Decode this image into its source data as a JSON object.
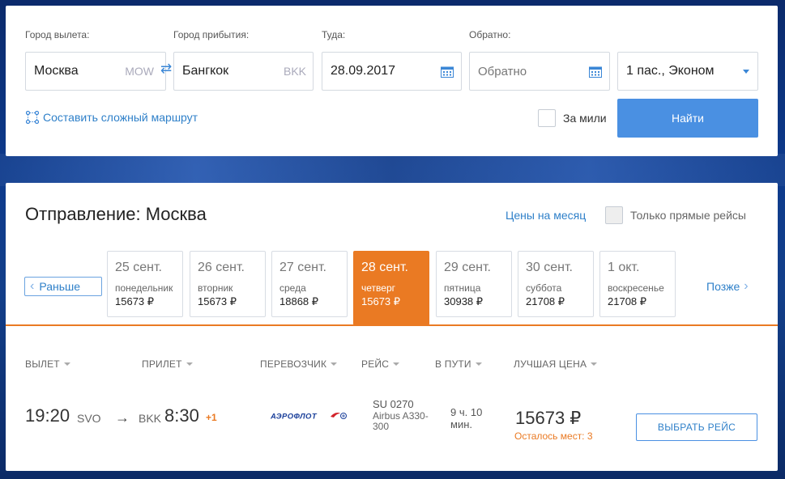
{
  "search": {
    "from_label": "Город вылета:",
    "from_value": "Москва",
    "from_code": "MOW",
    "to_label": "Город прибытия:",
    "to_value": "Бангкок",
    "to_code": "BKK",
    "depart_label": "Туда:",
    "depart_value": "28.09.2017",
    "return_label": "Обратно:",
    "return_placeholder": "Обратно",
    "passengers_value": "1 пас., Эконом",
    "complex_route_label": "Составить сложный маршрут",
    "miles_label": "За мили",
    "find_label": "Найти"
  },
  "results": {
    "title": "Отправление: Москва",
    "month_prices_label": "Цены на месяц",
    "direct_only_label": "Только прямые рейсы",
    "earlier_label": "Раньше",
    "later_label": "Позже",
    "days": [
      {
        "date": "25 сент.",
        "weekday": "понедельник",
        "price": "15673 ₽"
      },
      {
        "date": "26 сент.",
        "weekday": "вторник",
        "price": "15673 ₽"
      },
      {
        "date": "27 сент.",
        "weekday": "среда",
        "price": "18868 ₽"
      },
      {
        "date": "28 сент.",
        "weekday": "четверг",
        "price": "15673 ₽"
      },
      {
        "date": "29 сент.",
        "weekday": "пятница",
        "price": "30938 ₽"
      },
      {
        "date": "30 сент.",
        "weekday": "суббота",
        "price": "21708 ₽"
      },
      {
        "date": "1 окт.",
        "weekday": "воскресенье",
        "price": "21708 ₽"
      }
    ],
    "active_day_index": 3,
    "columns": [
      "ВЫЛЕТ",
      "ПРИЛЕТ",
      "ПЕРЕВОЗЧИК",
      "РЕЙС",
      "В ПУТИ",
      "ЛУЧШАЯ ЦЕНА"
    ],
    "flight": {
      "dep_time": "19:20",
      "dep_airport": "SVO",
      "arrow": "→",
      "arr_airport": "BKK",
      "arr_time": "8:30",
      "plus_day": "+1",
      "airline_logo_text": "АЭРОФЛОТ",
      "flight_no": "SU 0270",
      "aircraft": "Airbus A330-300",
      "duration": "9 ч. 10 мин.",
      "price": "15673 ₽",
      "seats_left": "Осталось мест: 3",
      "choose_label": "ВЫБРАТЬ РЕЙС"
    }
  },
  "colors": {
    "accent_blue": "#4a90e2",
    "link_blue": "#2f80c9",
    "active_orange": "#ea7a23",
    "airline_blue": "#1a3f9a",
    "airline_red": "#d3242b"
  },
  "icons": {
    "swap": "swap-icon",
    "calendar": "calendar-icon",
    "route": "route-icon",
    "dropdown": "chevron-down-icon"
  }
}
